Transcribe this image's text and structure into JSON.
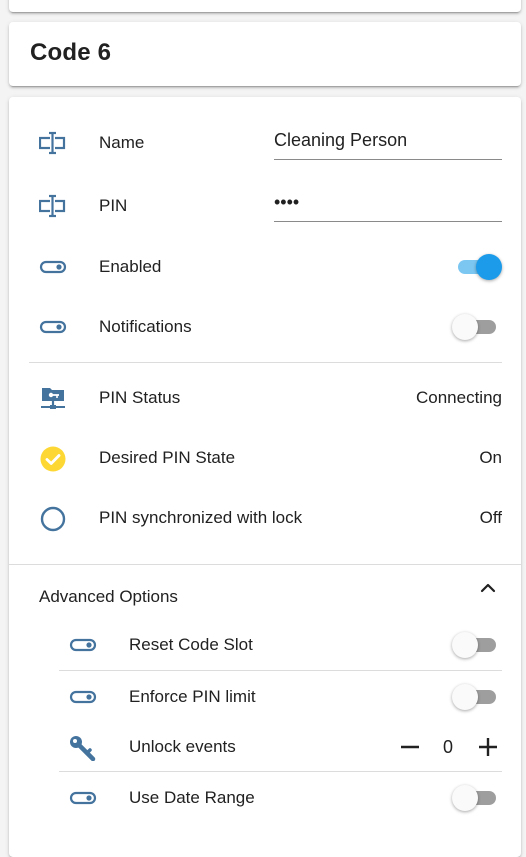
{
  "header": {
    "title": "Code 6"
  },
  "fields": {
    "name": {
      "label": "Name",
      "value": "Cleaning Person",
      "icon": "textbox-icon"
    },
    "pin": {
      "label": "PIN",
      "value": "••••",
      "icon": "textbox-icon"
    }
  },
  "toggles": {
    "enabled": {
      "label": "Enabled",
      "on": true,
      "icon": "toggle-switch-icon"
    },
    "notifications": {
      "label": "Notifications",
      "on": false,
      "icon": "toggle-switch-icon"
    }
  },
  "status": {
    "pin_status": {
      "label": "PIN Status",
      "value": "Connecting",
      "icon": "lan-connect-icon"
    },
    "desired_state": {
      "label": "Desired PIN State",
      "value": "On",
      "icon": "check-circle-icon"
    },
    "synchronized": {
      "label": "PIN synchronized with lock",
      "value": "Off",
      "icon": "circle-outline-icon"
    }
  },
  "advanced": {
    "title": "Advanced Options",
    "expanded": true,
    "reset_slot": {
      "label": "Reset Code Slot",
      "on": false
    },
    "enforce_limit": {
      "label": "Enforce PIN limit",
      "on": false
    },
    "unlock_events": {
      "label": "Unlock events",
      "value": "0",
      "icon": "key-icon"
    },
    "date_range": {
      "label": "Use Date Range",
      "on": false
    }
  },
  "colors": {
    "icon_blue": "#44739e",
    "accent": "#1b9bea",
    "accent_track": "#7cc7f2",
    "check_yellow": "#fdd835"
  }
}
